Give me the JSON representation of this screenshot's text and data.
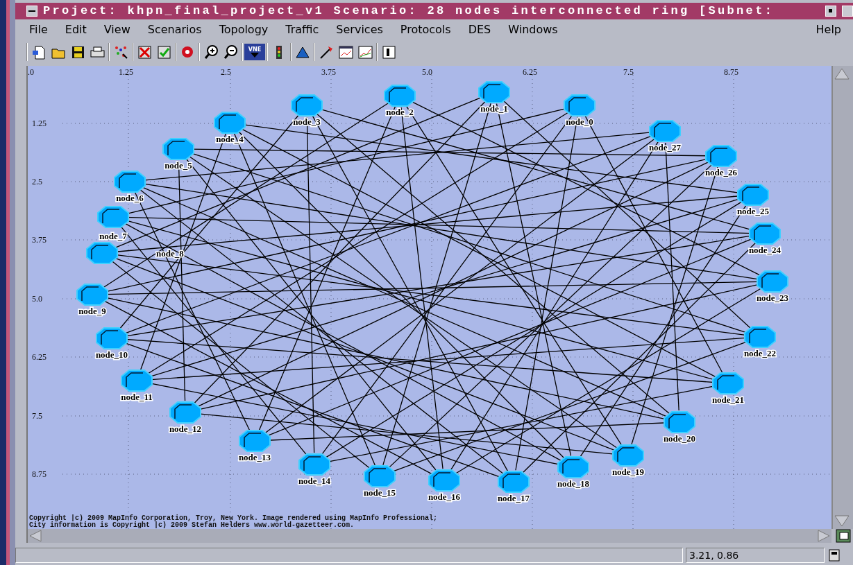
{
  "window": {
    "title": "Project: khpn_final_project_v1 Scenario: 28 nodes interconnected ring  [Subnet:"
  },
  "menu": [
    {
      "label": "File"
    },
    {
      "label": "Edit"
    },
    {
      "label": "View"
    },
    {
      "label": "Scenarios"
    },
    {
      "label": "Topology"
    },
    {
      "label": "Traffic"
    },
    {
      "label": "Services"
    },
    {
      "label": "Protocols"
    },
    {
      "label": "DES"
    },
    {
      "label": "Windows"
    },
    {
      "label": "Help"
    }
  ],
  "toolbar": {
    "vne_label": "VNE"
  },
  "map": {
    "x_ticks": [
      ".0",
      "1.25",
      "2.5",
      "3.75",
      "5.0",
      "6.25",
      "7.5",
      "8.75"
    ],
    "y_ticks": [
      "1.25",
      "2.5",
      "3.75",
      "5.0",
      "6.25",
      "7.5",
      "8.75"
    ],
    "nodes": [
      {
        "label": "node_1"
      },
      {
        "label": "node_2"
      },
      {
        "label": "node_3"
      },
      {
        "label": "node_0"
      },
      {
        "label": "node_4"
      },
      {
        "label": "node_27"
      },
      {
        "label": "node_5"
      },
      {
        "label": "node_26"
      },
      {
        "label": "node_6"
      },
      {
        "label": "node_25"
      },
      {
        "label": "node_7"
      },
      {
        "label": "node_24"
      },
      {
        "label": "node_8"
      },
      {
        "label": "node_23"
      },
      {
        "label": "node_9"
      },
      {
        "label": "node_22"
      },
      {
        "label": "node_10"
      },
      {
        "label": "node_11"
      },
      {
        "label": "node_21"
      },
      {
        "label": "node_12"
      },
      {
        "label": "node_20"
      },
      {
        "label": "node_13"
      },
      {
        "label": "node_19"
      },
      {
        "label": "node_14"
      },
      {
        "label": "node_18"
      },
      {
        "label": "node_15"
      },
      {
        "label": "node_16"
      },
      {
        "label": "node_17"
      }
    ],
    "copyright": [
      "Copyright |c) 2009 MapInfo Corporation, Troy, New York. Image rendered using MapInfo Professional;",
      "City information is Copyright |c) 2009 Stefan Helders www.world-gazetteer.com."
    ]
  },
  "status_bar": {
    "coordinates": "3.21, 0.86"
  }
}
